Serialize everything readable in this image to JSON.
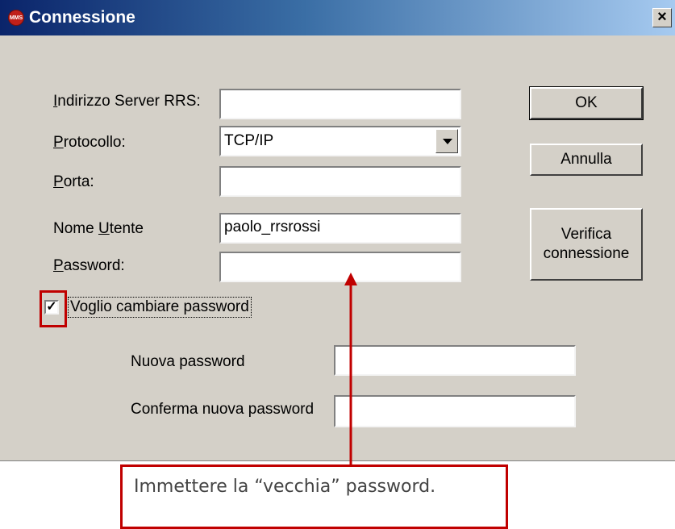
{
  "window": {
    "title": "Connessione",
    "icon_label": "MMS",
    "close_glyph": "×"
  },
  "form": {
    "server": {
      "label_u": "I",
      "label_rest": "ndirizzo Server RRS:",
      "value": ""
    },
    "protocol": {
      "label_u": "P",
      "label_rest": "rotocollo:",
      "value": "TCP/IP"
    },
    "port": {
      "label_u": "P",
      "label_rest": "orta:",
      "value": ""
    },
    "user": {
      "label_pre": "Nome ",
      "label_u": "U",
      "label_rest": "tente",
      "value": "paolo_rrsrossi"
    },
    "password": {
      "label_u": "P",
      "label_rest": "assword:",
      "value": ""
    },
    "change_pw": {
      "label_u": "V",
      "label_rest": "oglio cambiare password",
      "checked": true,
      "check_glyph": "✓"
    },
    "new_password": {
      "label": "Nuova password",
      "value": ""
    },
    "confirm_password": {
      "label": "Conferma nuova password",
      "value": ""
    }
  },
  "buttons": {
    "ok": "OK",
    "cancel": "Annulla",
    "verify_line1": "Verifica",
    "verify_line2": "connessione"
  },
  "annotation": {
    "callout_text": "Immettere la “vecchia” password.",
    "accent_color": "#c00000"
  }
}
